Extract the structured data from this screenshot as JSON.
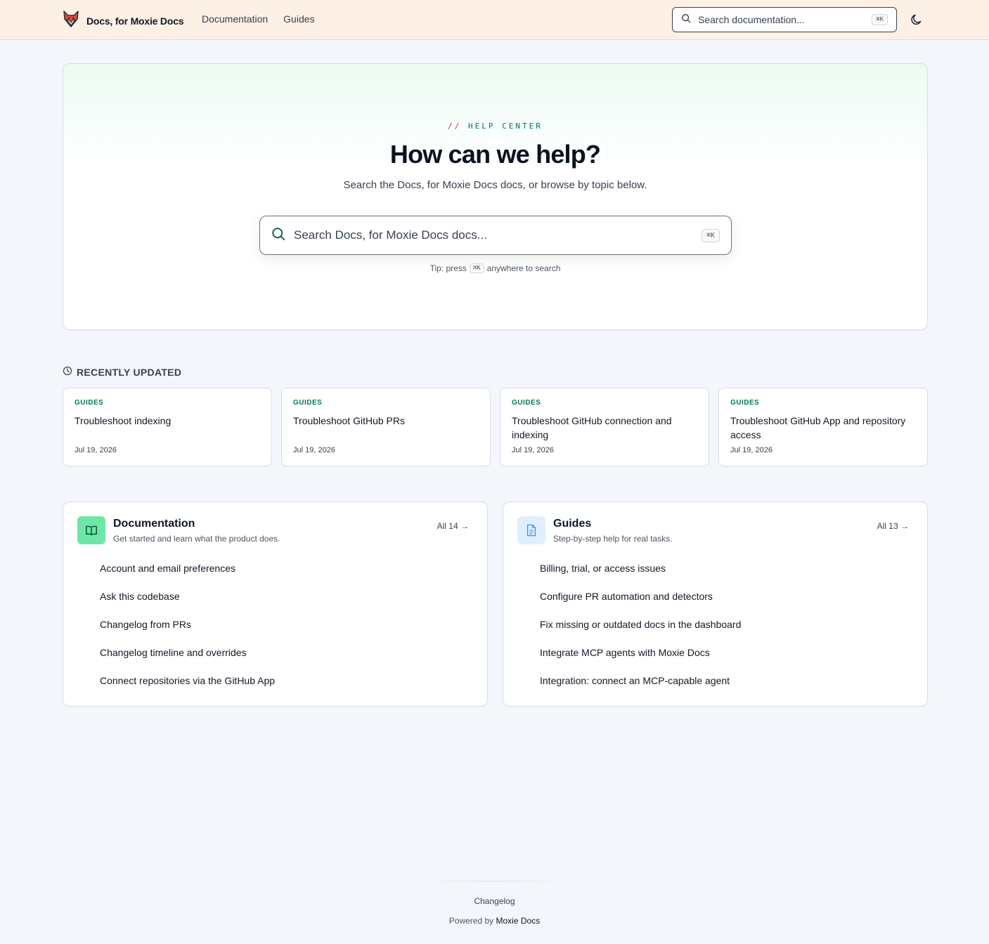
{
  "header": {
    "brand_name": "Docs, for Moxie Docs",
    "logo_icon": "fox-logo-icon",
    "nav": [
      {
        "label": "Documentation"
      },
      {
        "label": "Guides"
      }
    ],
    "search": {
      "placeholder": "Search documentation...",
      "shortcut": "⌘K"
    },
    "theme_icon": "moon-icon"
  },
  "hero": {
    "eyebrow_slash": "//",
    "eyebrow": "HELP CENTER",
    "title": "How can we help?",
    "subtitle": "Search the Docs, for Moxie Docs docs, or browse by topic below.",
    "search": {
      "placeholder": "Search Docs, for Moxie Docs docs...",
      "shortcut": "⌘K"
    },
    "tip_prefix": "Tip: press",
    "tip_key": "⌘K",
    "tip_suffix": "anywhere to search"
  },
  "recent": {
    "heading": "RECENTLY UPDATED",
    "items": [
      {
        "category": "GUIDES",
        "title": "Troubleshoot indexing",
        "date": "Jul 19, 2026"
      },
      {
        "category": "GUIDES",
        "title": "Troubleshoot GitHub PRs",
        "date": "Jul 19, 2026"
      },
      {
        "category": "GUIDES",
        "title": "Troubleshoot GitHub connection and indexing",
        "date": "Jul 19, 2026"
      },
      {
        "category": "GUIDES",
        "title": "Troubleshoot GitHub App and repository access",
        "date": "Jul 19, 2026"
      }
    ]
  },
  "sections": {
    "documentation": {
      "title": "Documentation",
      "description": "Get started and learn what the product does.",
      "all_label": "All 14 →",
      "icon": "book-icon",
      "items": [
        "Account and email preferences",
        "Ask this codebase",
        "Changelog from PRs",
        "Changelog timeline and overrides",
        "Connect repositories via the GitHub App"
      ]
    },
    "guides": {
      "title": "Guides",
      "description": "Step-by-step help for real tasks.",
      "all_label": "All 13 →",
      "icon": "document-icon",
      "items": [
        "Billing, trial, or access issues",
        "Configure PR automation and detectors",
        "Fix missing or outdated docs in the dashboard",
        "Integrate MCP agents with Moxie Docs",
        "Integration: connect an MCP-capable agent"
      ]
    }
  },
  "footer": {
    "changelog": "Changelog",
    "powered_prefix": "Powered by",
    "powered_brand": "Moxie Docs"
  },
  "colors": {
    "accent_green": "#047857",
    "accent_red": "#dc2626",
    "header_bg": "#fcf1e4",
    "page_bg": "#f3f6fa"
  }
}
